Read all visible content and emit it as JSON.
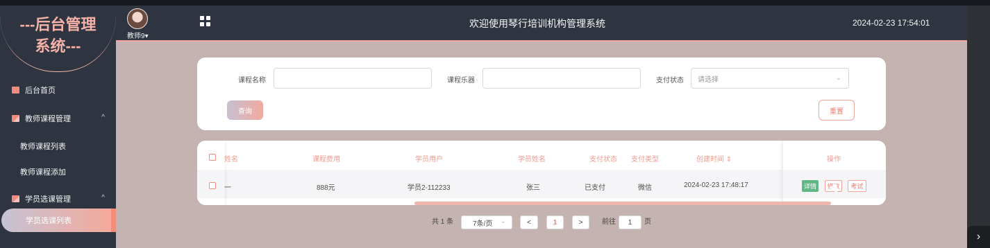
{
  "app": {
    "brand_line1": "---后台管理",
    "brand_line2": "系统---",
    "teacher": "教师9",
    "caret": "▾",
    "title": "欢迎使用琴行培训机构管理系统",
    "time": "2024-02-23 17:54:01"
  },
  "sidebar": {
    "items": [
      {
        "label": "后台首页"
      },
      {
        "label": "教师课程管理",
        "caret": "^"
      },
      {
        "label": "教师课程列表"
      },
      {
        "label": "教师课程添加"
      },
      {
        "label": "学员选课管理",
        "caret": "^"
      },
      {
        "label": "学员选课列表"
      }
    ]
  },
  "search": {
    "course_name_label": "课程名称",
    "course_name_value": "",
    "instrument_label": "课程乐器",
    "instrument_value": "",
    "pay_status_label": "支付状态",
    "pay_status_placeholder": "请选择",
    "query": "查询",
    "reset": "重置"
  },
  "table": {
    "headers": [
      "姓名",
      "课程费用",
      "学员用户",
      "学员姓名",
      "支付状态",
      "支付类型",
      "创建时间 ⇕",
      "操作"
    ],
    "row": {
      "name": "一",
      "fee": "888元",
      "student_user": "学员2-112233",
      "student_name": "张三",
      "pay_status": "已支付",
      "pay_type": "微信",
      "created": "2024-02-23 17:48:17",
      "actions": [
        "详情",
        "修改",
        "考试"
      ]
    }
  },
  "pagination": {
    "total": "共 1 条",
    "page_size": "7条/页",
    "prev": "<",
    "page": "1",
    "next": ">",
    "goto_label": "前往",
    "goto_value": "1",
    "page_unit": "页"
  },
  "colors": {
    "accent": "#f28b7f",
    "header": "#2f3540",
    "main": "#c4b3b1"
  }
}
